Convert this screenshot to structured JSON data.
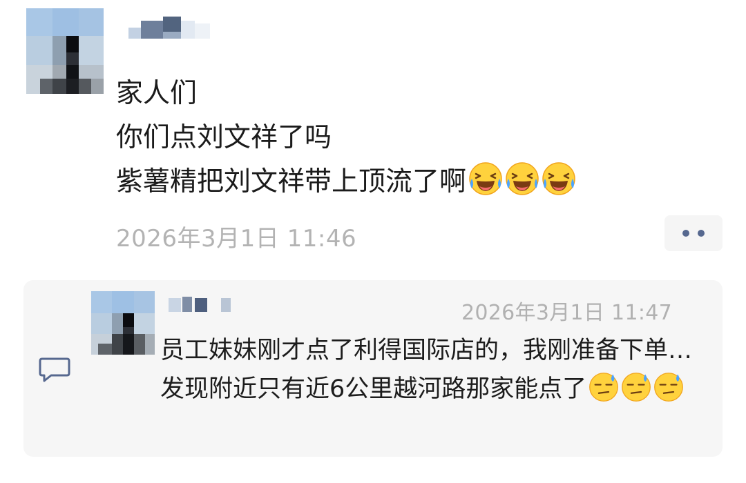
{
  "post": {
    "lines": [
      "家人们",
      "你们点刘文祥了吗",
      "紫薯精把刘文祥带上顶流了啊"
    ],
    "line3_emojis": [
      "laughing-crying-emoji",
      "laughing-crying-emoji",
      "laughing-crying-emoji"
    ],
    "timestamp": "2026年3月1日 11:46",
    "more_icon": "more-dots-icon",
    "avatar": "pixelated-avatar",
    "author": "pixelated-username"
  },
  "comment": {
    "timestamp": "2026年3月1日 11:47",
    "text": "员工妹妹刚才点了利得国际店的，我刚准备下单…发现附近只有近6公里越河路那家能点了",
    "trailing_emojis": [
      "sweat-emoji",
      "sweat-emoji",
      "sweat-emoji"
    ],
    "icon": "comment-bubble-icon",
    "avatar": "pixelated-avatar",
    "author": "pixelated-username"
  },
  "colors": {
    "background": "#ffffff",
    "comment_background": "#f6f6f6",
    "timestamp": "#b3b3b3",
    "accent": "#56688f"
  }
}
